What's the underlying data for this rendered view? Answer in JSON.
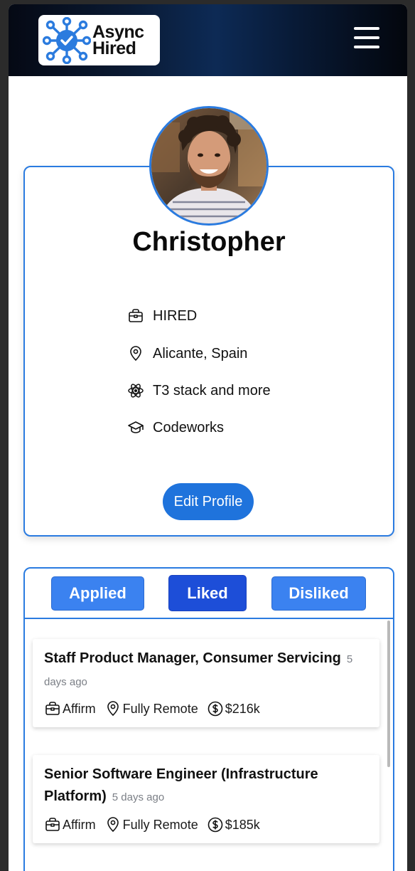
{
  "header": {
    "logo_line1": "Async",
    "logo_line2": "Hired",
    "menu_icon": "hamburger-menu-icon"
  },
  "profile": {
    "name": "Christopher",
    "status": "HIRED",
    "location": "Alicante, Spain",
    "stack": "T3 stack and more",
    "education": "Codeworks",
    "edit_label": "Edit Profile"
  },
  "tabs": [
    {
      "label": "Applied",
      "active": false
    },
    {
      "label": "Liked",
      "active": true
    },
    {
      "label": "Disliked",
      "active": false
    }
  ],
  "jobs": [
    {
      "title": "Staff Product Manager, Consumer Servicing",
      "time": "5 days ago",
      "company": "Affirm",
      "location": "Fully Remote",
      "salary": "$216k"
    },
    {
      "title": "Senior Software Engineer (Infrastructure Platform)",
      "time": "5 days ago",
      "company": "Affirm",
      "location": "Fully Remote",
      "salary": "$185k"
    }
  ],
  "colors": {
    "accent": "#2a7be0",
    "button": "#1f73dc",
    "tab_inactive": "#3b82f0",
    "tab_active": "#1d4ed8",
    "muted": "#7b7f86"
  }
}
